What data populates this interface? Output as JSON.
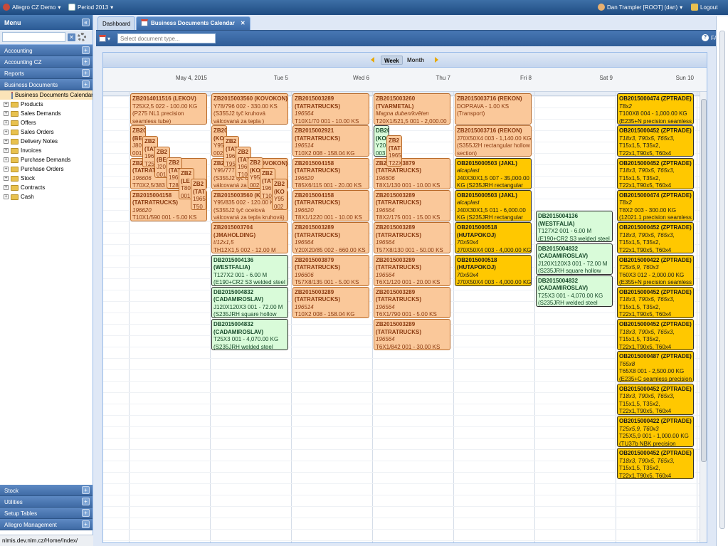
{
  "topbar": {
    "app_title": "Allegro CZ Demo",
    "period": "Period 2013",
    "user": "Dan Trampler [ROOT] (dan)",
    "logout": "Logout"
  },
  "menu": {
    "title": "Menu",
    "sections_top": [
      "Accounting",
      "Accounting CZ",
      "Reports",
      "Business Documents"
    ],
    "tree": [
      {
        "label": "Business Documents Calendar",
        "selected": true
      },
      {
        "label": "Products"
      },
      {
        "label": "Sales Demands"
      },
      {
        "label": "Offers"
      },
      {
        "label": "Sales Orders"
      },
      {
        "label": "Delivery Notes"
      },
      {
        "label": "Invoices"
      },
      {
        "label": "Purchase Demands"
      },
      {
        "label": "Purchase Orders"
      },
      {
        "label": "Stock"
      },
      {
        "label": "Contracts"
      },
      {
        "label": "Cash"
      }
    ],
    "sections_bottom": [
      "Stock",
      "Utilities",
      "Setup Tables",
      "Allegro Management"
    ],
    "status_url": "nlmis.dev.nlm.cz/Home/Index/"
  },
  "tabs": [
    {
      "label": "Dashboard"
    },
    {
      "label": "Business Documents Calendar",
      "active": true
    }
  ],
  "toolbar": {
    "select_placeholder": "Select document type...",
    "faq": "FAQ"
  },
  "calendar": {
    "views": [
      "Week",
      "Month"
    ],
    "active_view": "Week",
    "days": [
      "May 4, 2015",
      "Tue 5",
      "Wed 6",
      "Thu 7",
      "Fri 8",
      "Sat 9",
      "Sun 10"
    ],
    "colors": {
      "orange": "#fac89a",
      "green": "#d9fbd9",
      "yellow": "#ffc800"
    },
    "events": [
      {
        "day": 0,
        "slot": 0,
        "style": "o",
        "lines": [
          "ZB2014011516 (LEKOV)",
          "T25X2,5 022 - 100.00 KG",
          "(P275 NL1 precision",
          "seamless tube)"
        ]
      },
      {
        "day": 0,
        "slot": 1,
        "style": "o",
        "lines": [
          "ZB20",
          "(BE",
          "J80",
          "001"
        ]
      },
      {
        "day": 0,
        "slot": 1,
        "style": "o",
        "offset": 1,
        "lines": [
          "ZB2",
          "(TAT",
          "1965",
          "T25"
        ]
      },
      {
        "day": 0,
        "slot": 1,
        "style": "o",
        "offset": 2,
        "lines": [
          "ZB2",
          "(BE",
          "J20",
          "001"
        ]
      },
      {
        "day": 0,
        "slot": 1,
        "style": "o",
        "offset": 3,
        "lines": [
          "ZB2",
          "(TAT",
          "1965",
          "T28"
        ]
      },
      {
        "day": 0,
        "slot": 1,
        "style": "o",
        "offset": 4,
        "lines": [
          "ZB2",
          "(LE",
          "T80",
          "001"
        ]
      },
      {
        "day": 0,
        "slot": 1,
        "style": "o",
        "offset": 5,
        "lines": [
          "ZB2",
          "(TAT",
          "1965",
          "T50"
        ]
      },
      {
        "day": 0,
        "slot": 2,
        "style": "o",
        "lines": [
          "ZB2015003879",
          "(TATRATRUCKS)",
          "196606",
          "T70X2,5/383 001 - 20.00 KS"
        ]
      },
      {
        "day": 0,
        "slot": 3,
        "style": "o",
        "lines": [
          "ZB2015004158",
          "(TATRATRUCKS)",
          "196620",
          "T10X1/590 001 - 5.00 KS",
          "(E235+N seamless precision"
        ]
      },
      {
        "day": 1,
        "slot": 0,
        "style": "o",
        "lines": [
          "ZB2015003560 (KOVOKON)",
          "Y78/796 002 - 330.00 KS",
          "(S355J2 tyč kruhová",
          "válcovaná za tepla )"
        ]
      },
      {
        "day": 1,
        "slot": 1,
        "style": "o",
        "lines": [
          "ZB20",
          "(KO",
          "Y95",
          "002"
        ]
      },
      {
        "day": 1,
        "slot": 1,
        "style": "o",
        "offset": 1,
        "lines": [
          "ZB2",
          "(TAT",
          "1965",
          "T95"
        ]
      },
      {
        "day": 1,
        "slot": 1,
        "style": "o",
        "offset": 2,
        "lines": [
          "ZB2",
          "(TAT",
          "1965",
          "T10"
        ]
      },
      {
        "day": 1,
        "slot": 1,
        "style": "o",
        "offset": 3,
        "lines": [
          "ZB2",
          "(KO",
          "Y95",
          "002"
        ]
      },
      {
        "day": 1,
        "slot": 1,
        "style": "o",
        "offset": 4,
        "lines": [
          "ZB2",
          "(TAT",
          "1965",
          "T10"
        ]
      },
      {
        "day": 1,
        "slot": 1,
        "style": "o",
        "offset": 5,
        "lines": [
          "ZB2",
          "(KO",
          "Y95",
          "002"
        ]
      },
      {
        "day": 1,
        "slot": 2,
        "style": "o",
        "lines": [
          "ZB2015003560 (KOVOKON)",
          "Y95/777 002 - 60.00 KS",
          "(S355J2 tyč ocelová",
          "válcovaná za tepla kruhová)"
        ]
      },
      {
        "day": 1,
        "slot": 3,
        "style": "o",
        "lines": [
          "ZB2015003560 (KOVOKON)",
          "Y95/835 002 - 120.00 KS",
          "(S355J2 tyč ocelová",
          "válcovaná za tepla kruhová)"
        ]
      },
      {
        "day": 1,
        "slot": 4,
        "style": "o",
        "lines": [
          "ZB2015003704",
          "(JMAHOLDING)",
          "t/12x1,5",
          "TH12X1,5 002 - 12.00 M"
        ]
      },
      {
        "day": 1,
        "slot": 5,
        "style": "g",
        "lines": [
          "DB2015004136",
          "(WESTFALIA)",
          "T127X2 001 - 6.00 M",
          "(E190+CR2 S3 welded steel"
        ]
      },
      {
        "day": 1,
        "slot": 6,
        "style": "g",
        "lines": [
          "DB2015004832",
          "(CADAMIROSLAV)",
          "J120X120X3 001 - 72.00 M",
          "(S235JRH square hollow"
        ]
      },
      {
        "day": 1,
        "slot": 7,
        "style": "g",
        "lines": [
          "DB2015004832",
          "(CADAMIROSLAV)",
          "T25X3 001 - 4,070.00 KG",
          "(S235JRH welded steel",
          "tube)"
        ]
      },
      {
        "day": 2,
        "slot": 0,
        "style": "o",
        "lines": [
          "ZB2015003289",
          "(TATRATRUCKS)",
          "196564",
          "T10X1/70 001 - 10.00 KS"
        ]
      },
      {
        "day": 2,
        "slot": 1,
        "style": "o",
        "lines": [
          "ZB2015002921",
          "(TATRATRUCKS)",
          "196514",
          "T10X2 008 - 158.04 KG"
        ]
      },
      {
        "day": 2,
        "slot": 2,
        "style": "o",
        "lines": [
          "ZB2015004158",
          "(TATRATRUCKS)",
          "196620",
          "T85X6/115 001 - 20.00 KS"
        ]
      },
      {
        "day": 2,
        "slot": 3,
        "style": "o",
        "lines": [
          "ZB2015004158",
          "(TATRATRUCKS)",
          "196620",
          "T8X1/1220 001 - 10.00 KS"
        ]
      },
      {
        "day": 2,
        "slot": 4,
        "style": "o",
        "lines": [
          "ZB2015003289",
          "(TATRATRUCKS)",
          "196564",
          "Y20X20/85 002 - 660.00 KS"
        ]
      },
      {
        "day": 2,
        "slot": 5,
        "style": "o",
        "lines": [
          "ZB2015003879",
          "(TATRATRUCKS)",
          "196606",
          "T57X8/135 001 - 5.00 KS"
        ]
      },
      {
        "day": 2,
        "slot": 6,
        "style": "o",
        "lines": [
          "ZB2015003289",
          "(TATRATRUCKS)",
          "196514",
          "T10X2 008 - 158.04 KG"
        ]
      },
      {
        "day": 3,
        "slot": 0,
        "style": "o",
        "lines": [
          "ZB2015003260",
          "(TVARMETAL)",
          "Magna duben/květen",
          "T20X1/521,5 001 - 2,000.00"
        ]
      },
      {
        "day": 3,
        "slot": 1,
        "style": "g",
        "lines": [
          "DB20",
          "(KO",
          "Y20",
          "003"
        ]
      },
      {
        "day": 3,
        "slot": 1,
        "style": "o",
        "offset": 1,
        "lines": [
          "ZB2",
          "(TAT",
          "1965",
          "T22X"
        ]
      },
      {
        "day": 3,
        "slot": 2,
        "style": "o",
        "lines": [
          "ZB2015003879",
          "(TATRATRUCKS)",
          "196606",
          "T8X1/130 001 - 10.00 KS"
        ]
      },
      {
        "day": 3,
        "slot": 3,
        "style": "o",
        "lines": [
          "ZB2015003289",
          "(TATRATRUCKS)",
          "196564",
          "T8X2/175 001 - 15.00 KS"
        ]
      },
      {
        "day": 3,
        "slot": 4,
        "style": "o",
        "lines": [
          "ZB2015003289",
          "(TATRATRUCKS)",
          "196564",
          "T57X8/130 001 - 50.00 KS"
        ]
      },
      {
        "day": 3,
        "slot": 5,
        "style": "o",
        "lines": [
          "ZB2015003289",
          "(TATRATRUCKS)",
          "196564",
          "T6X1/120 001 - 20.00 KS"
        ]
      },
      {
        "day": 3,
        "slot": 6,
        "style": "o",
        "lines": [
          "ZB2015003289",
          "(TATRATRUCKS)",
          "196564",
          "T6X1/790 001 - 5.00 KS"
        ]
      },
      {
        "day": 3,
        "slot": 7,
        "style": "o",
        "lines": [
          "ZB2015003289",
          "(TATRATRUCKS)",
          "196564",
          "T6X1/842 001 - 30.00 KS"
        ]
      },
      {
        "day": 4,
        "slot": 0,
        "style": "o",
        "lines": [
          "ZB2015003716 (REKON)",
          "DOPRAVA - 1.00 KS",
          "(Transport)"
        ]
      },
      {
        "day": 4,
        "slot": 1,
        "style": "o",
        "lines": [
          "ZB2015003716 (REKON)",
          "J70X50X4 003 - 1,140.00 KG",
          "(S355J2H rectangular hollow",
          "section)"
        ]
      },
      {
        "day": 4,
        "slot": 2,
        "style": "y",
        "lines": [
          "OB2015000503 (JAKL)",
          "alcaplast",
          "J40X30X1,5 007 - 35,000.00",
          "KG (S235JRH rectangular"
        ]
      },
      {
        "day": 4,
        "slot": 3,
        "style": "y",
        "lines": [
          "OB2015000503 (JAKL)",
          "alcaplast",
          "J40X30X1,5 011 - 6,000.00",
          "KG (S235JRH rectangular"
        ]
      },
      {
        "day": 4,
        "slot": 4,
        "style": "y",
        "lines": [
          "OB2015000518",
          "(HUTAPOKOJ)",
          "70x50x4",
          "J70X50X4 003 - 4,000.00 KG"
        ]
      },
      {
        "day": 4,
        "slot": 5,
        "style": "y",
        "lines": [
          "OB2015000518",
          "(HUTAPOKOJ)",
          "70x50x4",
          "J70X50X4 003 - 4,000.00 KG"
        ]
      },
      {
        "day": 5,
        "slot": 3.65,
        "style": "g",
        "lines": [
          "DB2015004136",
          "(WESTFALIA)",
          "T127X2 001 - 6.00 M",
          "(E190+CR2 S3 welded steel"
        ]
      },
      {
        "day": 5,
        "slot": 4.65,
        "style": "g",
        "lines": [
          "DB2015004832",
          "(CADAMIROSLAV)",
          "J120X120X3 001 - 72.00 M",
          "(S235JRH square hollow"
        ]
      },
      {
        "day": 5,
        "slot": 5.65,
        "style": "g",
        "lines": [
          "DB2015004832",
          "(CADAMIROSLAV)",
          "T25X3 001 - 4,070.00 KG",
          "(S235JRH welded steel",
          "tube)"
        ]
      },
      {
        "day": 6,
        "slot": 0,
        "style": "y",
        "lines": [
          "OB2015000474 (ZPTRADE)",
          "T8x2",
          "T100X8 004 - 1,000.00 KG",
          "(E235+N precision seamless"
        ]
      },
      {
        "day": 6,
        "slot": 1,
        "style": "y",
        "lines": [
          "OB2015000452 (ZPTRADE)",
          "T18x3, T90x5, T65x3,",
          "T15x1,5, T35x2,",
          "T22x1,T90x5, T60x4"
        ]
      },
      {
        "day": 6,
        "slot": 2,
        "style": "y",
        "lines": [
          "OB2015000452 (ZPTRADE)",
          "T18x3, T90x5, T65x3,",
          "T15x1,5, T35x2,",
          "T22x1,T90x5, T60x4"
        ]
      },
      {
        "day": 6,
        "slot": 3,
        "style": "y",
        "lines": [
          "OB2015000474 (ZPTRADE)",
          "T8x2",
          "T8X2 003 - 300.00 KG",
          "(12021.1 precision seamless"
        ]
      },
      {
        "day": 6,
        "slot": 4,
        "style": "y",
        "lines": [
          "OB2015000452 (ZPTRADE)",
          "T18x3, T90x5, T65x3,",
          "T15x1,5, T35x2,",
          "T22x1,T90x5, T60x4"
        ]
      },
      {
        "day": 6,
        "slot": 5,
        "style": "y",
        "lines": [
          "OB2015000422 (ZPTRADE)",
          "T25x5,9, T60x3",
          "T60X3 012 - 2,000.00 KG",
          "(E355+N precision seamless"
        ]
      },
      {
        "day": 6,
        "slot": 6,
        "style": "y",
        "lines": [
          "OB2015000452 (ZPTRADE)",
          "T18x3, T90x5, T65x3,",
          "T15x1,5, T35x2,",
          "T22x1,T90x5, T60x4"
        ]
      },
      {
        "day": 6,
        "slot": 7,
        "style": "y",
        "lines": [
          "OB2015000452 (ZPTRADE)",
          "T18x3, T90x5, T65x3,",
          "T15x1,5, T35x2,",
          "T22x1,T90x5, T60x4"
        ]
      },
      {
        "day": 6,
        "slot": 8,
        "style": "y",
        "lines": [
          "OB2015000487 (ZPTRADE)",
          "T65x8",
          "T65X8 001 - 2,500.00 KG",
          "(E235+C seamless precision"
        ]
      },
      {
        "day": 6,
        "slot": 9,
        "style": "y",
        "lines": [
          "OB2015000452 (ZPTRADE)",
          "T18x3, T90x5, T65x3,",
          "T15x1,5, T35x2,",
          "T22x1,T90x5, T60x4"
        ]
      },
      {
        "day": 6,
        "slot": 10,
        "style": "y",
        "lines": [
          "OB2015000422 (ZPTRADE)",
          "T25x5,9, T60x3",
          "T25X5,9 001 - 1,000.00 KG",
          "(TU37b NBK precision"
        ]
      },
      {
        "day": 6,
        "slot": 11,
        "style": "y",
        "lines": [
          "OB2015000452 (ZPTRADE)",
          "T18x3, T90x5, T65x3,",
          "T15x1,5, T35x2,",
          "T22x1,T90x5, T60x4",
          "T22X1 001 - 1,000.00 KG"
        ]
      }
    ]
  }
}
